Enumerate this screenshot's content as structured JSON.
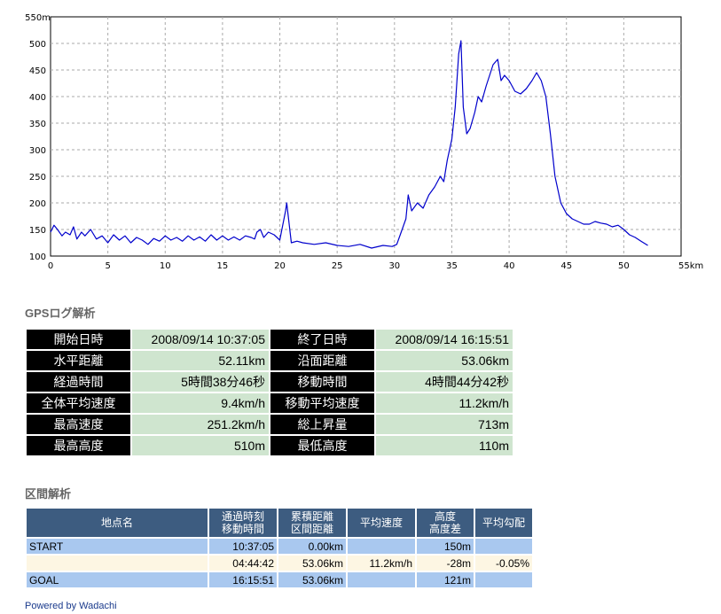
{
  "chart_data": {
    "type": "line",
    "title": "",
    "xlabel": "",
    "ylabel": "",
    "x_unit": "km",
    "y_unit": "m",
    "xlim": [
      0,
      55
    ],
    "ylim": [
      100,
      550
    ],
    "grid": true,
    "x_ticks": [
      0,
      5,
      10,
      15,
      20,
      25,
      30,
      35,
      40,
      45,
      50,
      55
    ],
    "y_ticks": [
      100,
      150,
      200,
      250,
      300,
      350,
      400,
      450,
      500,
      550
    ],
    "x_tick_labels": [
      "0",
      "5",
      "10",
      "15",
      "20",
      "25",
      "30",
      "35",
      "40",
      "45",
      "50",
      "55km"
    ],
    "y_tick_labels": [
      "100",
      "150",
      "200",
      "250",
      "300",
      "350",
      "400",
      "450",
      "500",
      "550m"
    ],
    "line_color": "#0000cc",
    "series": [
      {
        "x": [
          0,
          0.3,
          0.6,
          1.0,
          1.3,
          1.7,
          2.0,
          2.3,
          2.7,
          3.0,
          3.5,
          4.0,
          4.5,
          5.0,
          5.5,
          6.0,
          6.5,
          7.0,
          7.5,
          8.0,
          8.5,
          9.0,
          9.5,
          10.0,
          10.5,
          11.0,
          11.5,
          12.0,
          12.5,
          13.0,
          13.5,
          14.0,
          14.5,
          15.0,
          15.5,
          16.0,
          16.5,
          17.0,
          17.5,
          17.8,
          18.0,
          18.3,
          18.6,
          19.0,
          19.5,
          20.0,
          20.5,
          20.6,
          21.0,
          21.5,
          22.0,
          23.0,
          24.0,
          25.0,
          26.0,
          27.0,
          28.0,
          29.0,
          29.8,
          30.2,
          30.5,
          31.0,
          31.2,
          31.5,
          32.0,
          32.5,
          33.0,
          33.5,
          34.0,
          34.3,
          34.6,
          35.0,
          35.3,
          35.6,
          35.8,
          36.0,
          36.3,
          36.6,
          37.0,
          37.3,
          37.6,
          38.0,
          38.3,
          38.6,
          39.0,
          39.3,
          39.6,
          40.0,
          40.5,
          41.0,
          41.5,
          42.0,
          42.4,
          42.8,
          43.2,
          43.6,
          44.0,
          44.5,
          45.0,
          45.5,
          46.0,
          46.5,
          47.0,
          47.5,
          48.0,
          48.5,
          49.0,
          49.5,
          50.0,
          50.5,
          51.0,
          51.5,
          52.1
        ],
        "y": [
          145,
          158,
          150,
          138,
          145,
          140,
          155,
          132,
          145,
          138,
          150,
          132,
          138,
          125,
          140,
          130,
          138,
          125,
          135,
          130,
          122,
          133,
          128,
          138,
          130,
          135,
          128,
          138,
          130,
          136,
          128,
          140,
          130,
          138,
          130,
          136,
          130,
          138,
          135,
          132,
          145,
          150,
          135,
          145,
          140,
          130,
          185,
          200,
          125,
          128,
          125,
          122,
          125,
          120,
          118,
          122,
          115,
          120,
          118,
          122,
          140,
          170,
          215,
          185,
          200,
          190,
          215,
          230,
          250,
          240,
          280,
          320,
          380,
          480,
          505,
          380,
          330,
          340,
          370,
          400,
          390,
          420,
          440,
          460,
          470,
          430,
          440,
          430,
          410,
          405,
          415,
          430,
          445,
          430,
          400,
          330,
          250,
          200,
          180,
          170,
          165,
          160,
          160,
          165,
          162,
          160,
          155,
          158,
          150,
          140,
          135,
          128,
          120
        ]
      }
    ]
  },
  "gps_section": {
    "title": "GPSログ解析",
    "rows": [
      {
        "label1": "開始日時",
        "value1": "2008/09/14 10:37:05",
        "label2": "終了日時",
        "value2": "2008/09/14 16:15:51"
      },
      {
        "label1": "水平距離",
        "value1": "52.11km",
        "label2": "沿面距離",
        "value2": "53.06km"
      },
      {
        "label1": "経過時間",
        "value1": "5時間38分46秒",
        "label2": "移動時間",
        "value2": "4時間44分42秒"
      },
      {
        "label1": "全体平均速度",
        "value1": "9.4km/h",
        "label2": "移動平均速度",
        "value2": "11.2km/h"
      },
      {
        "label1": "最高速度",
        "value1": "251.2km/h",
        "label2": "総上昇量",
        "value2": "713m"
      },
      {
        "label1": "最高高度",
        "value1": "510m",
        "label2": "最低高度",
        "value2": "110m"
      }
    ]
  },
  "segment_section": {
    "title": "区間解析",
    "headers": {
      "point_name": "地点名",
      "time_line1": "通過時刻",
      "time_line2": "移動時間",
      "dist_line1": "累積距離",
      "dist_line2": "区間距離",
      "avg_speed": "平均速度",
      "alt_line1": "高度",
      "alt_line2": "高度差",
      "avg_grade": "平均勾配"
    },
    "rows": [
      {
        "kind": "end",
        "name": "START",
        "time": "10:37:05",
        "distance": "0.00km",
        "speed": "",
        "altitude": "150m",
        "grade": ""
      },
      {
        "kind": "mid",
        "name": "",
        "time": "04:44:42",
        "distance": "53.06km",
        "speed": "11.2km/h",
        "altitude": "-28m",
        "grade": "-0.05%"
      },
      {
        "kind": "end",
        "name": "GOAL",
        "time": "16:15:51",
        "distance": "53.06km",
        "speed": "",
        "altitude": "121m",
        "grade": ""
      }
    ]
  },
  "footer": {
    "powered_by": "Powered by Wadachi"
  }
}
